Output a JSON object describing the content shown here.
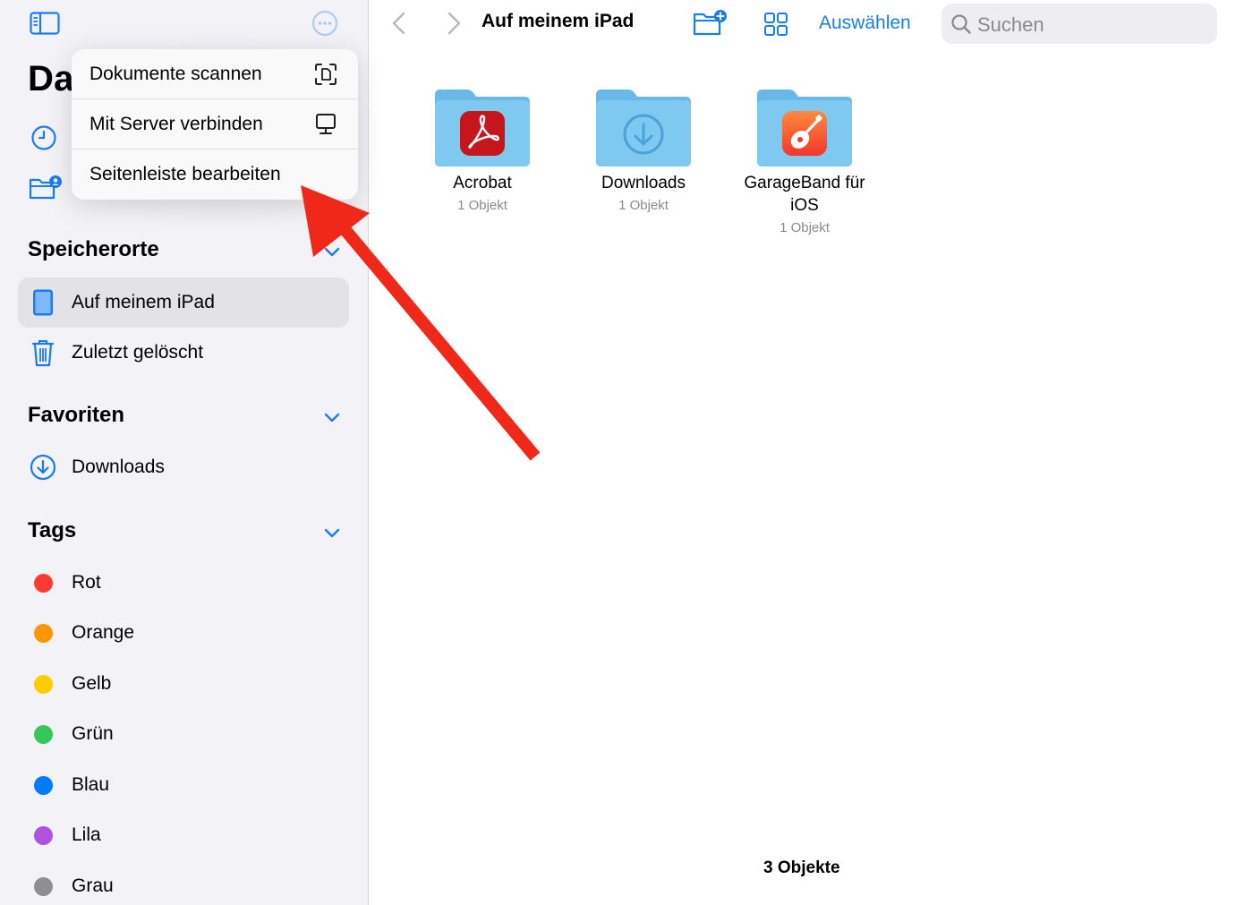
{
  "sidebar": {
    "title": "Dateien",
    "sections": {
      "locations_header": "Speicherorte",
      "favorites_header": "Favoriten",
      "tags_header": "Tags"
    },
    "locations": [
      {
        "label": "Auf meinem iPad",
        "icon": "ipad-icon",
        "selected": true
      },
      {
        "label": "Zuletzt gelöscht",
        "icon": "trash-icon",
        "selected": false
      }
    ],
    "favorites": [
      {
        "label": "Downloads",
        "icon": "download-circle-icon"
      }
    ],
    "tags": [
      {
        "label": "Rot",
        "color": "#ff3b30"
      },
      {
        "label": "Orange",
        "color": "#ff9500"
      },
      {
        "label": "Gelb",
        "color": "#ffcc00"
      },
      {
        "label": "Grün",
        "color": "#34c759"
      },
      {
        "label": "Blau",
        "color": "#007aff"
      },
      {
        "label": "Lila",
        "color": "#af52de"
      },
      {
        "label": "Grau",
        "color": "#8e8e93"
      }
    ]
  },
  "menu": {
    "items": [
      {
        "label": "Dokumente scannen",
        "icon": "scan-document-icon"
      },
      {
        "label": "Mit Server verbinden",
        "icon": "server-display-icon"
      },
      {
        "label": "Seitenleiste bearbeiten",
        "icon": ""
      }
    ]
  },
  "toolbar": {
    "title": "Auf meinem iPad",
    "select_label": "Auswählen",
    "search_placeholder": "Suchen"
  },
  "folders": [
    {
      "name": "Acrobat",
      "count": "1 Objekt",
      "icon": "acrobat-app-icon"
    },
    {
      "name": "Downloads",
      "count": "1 Objekt",
      "icon": "download-circle-icon"
    },
    {
      "name": "GarageBand für iOS",
      "count": "1 Objekt",
      "icon": "garageband-app-icon"
    }
  ],
  "footer": {
    "item_count": "3 Objekte"
  },
  "colors": {
    "accent": "#1a7cf5",
    "folder": "#7fc8f0",
    "annotation_arrow": "#f0281a"
  }
}
